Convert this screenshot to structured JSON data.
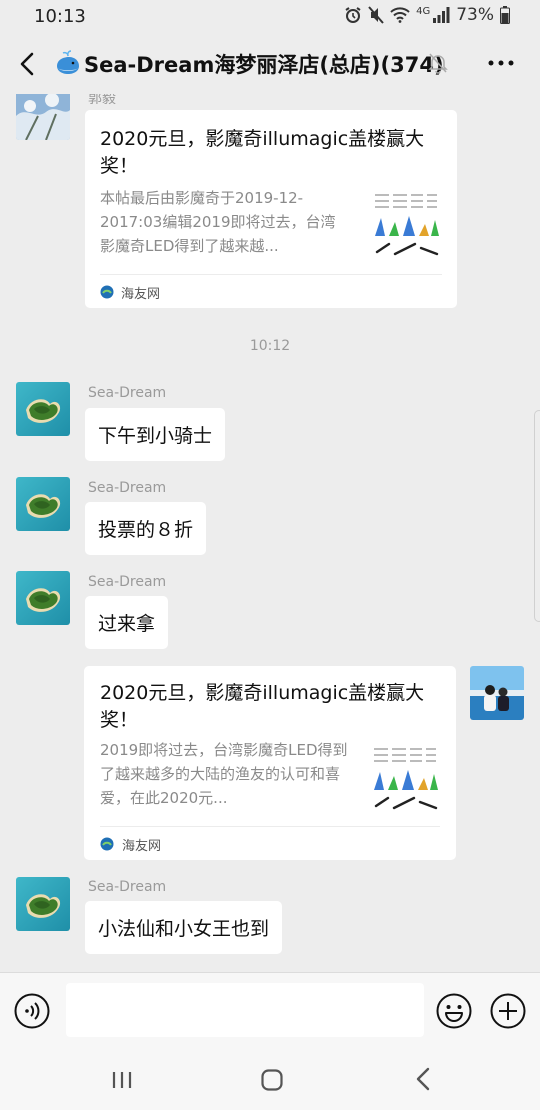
{
  "status": {
    "time": "10:13",
    "network": "4G",
    "battery": "73%"
  },
  "header": {
    "title": "Sea-Dream海梦丽泽店(总店)(374)"
  },
  "messages": [
    {
      "type": "card",
      "sender": "郭毅",
      "title": "2020元旦，影魔奇illumagic盖楼赢大奖！",
      "desc": "本帖最后由影魔奇于2019-12-2017:03编辑2019即将过去，台湾影魔奇LED得到了越来越...",
      "source": "海友网"
    },
    {
      "type": "time",
      "text": "10:12"
    },
    {
      "type": "text",
      "sender": "Sea-Dream",
      "text": "下午到小骑士"
    },
    {
      "type": "text",
      "sender": "Sea-Dream",
      "text": "投票的８折"
    },
    {
      "type": "text",
      "sender": "Sea-Dream",
      "text": "过来拿"
    },
    {
      "type": "card",
      "self": true,
      "title": "2020元旦，影魔奇illumagic盖楼赢大奖！",
      "desc": "2019即将过去，台湾影魔奇LED得到了越来越多的大陆的渔友的认可和喜爱，在此2020元...",
      "source": "海友网"
    },
    {
      "type": "text",
      "sender": "Sea-Dream",
      "text": "小法仙和小女王也到"
    }
  ],
  "input": {
    "placeholder": ""
  },
  "colors": {
    "background": "#ededed",
    "bubble": "#ffffff",
    "meta_text": "#9a9a9a"
  }
}
